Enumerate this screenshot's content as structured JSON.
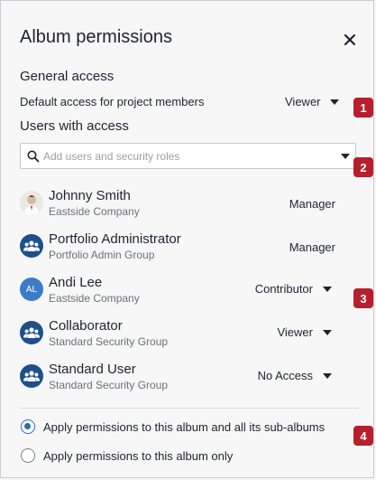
{
  "dialog": {
    "title": "Album permissions",
    "close_icon": "close-icon"
  },
  "general_access": {
    "heading": "General access",
    "label": "Default access for project members",
    "value": "Viewer"
  },
  "users_with_access": {
    "heading": "Users with access",
    "search_placeholder": "Add users and security roles",
    "search_value": ""
  },
  "users": [
    {
      "name": "Johnny Smith",
      "org": "Eastside Company",
      "role": "Manager",
      "editable": false,
      "avatar": "photo"
    },
    {
      "name": "Portfolio Administrator",
      "org": "Portfolio Admin Group",
      "role": "Manager",
      "editable": false,
      "avatar": "group-icon"
    },
    {
      "name": "Andi Lee",
      "org": "Eastside Company",
      "role": "Contributor",
      "editable": true,
      "avatar": "initials",
      "initials": "AL"
    },
    {
      "name": "Collaborator",
      "org": "Standard Security Group",
      "role": "Viewer",
      "editable": true,
      "avatar": "group-icon"
    },
    {
      "name": "Standard User",
      "org": "Standard Security Group",
      "role": "No Access",
      "editable": true,
      "avatar": "group-icon"
    }
  ],
  "apply_options": [
    {
      "label": "Apply permissions to this album and all its sub-albums",
      "checked": true
    },
    {
      "label": "Apply permissions to this album only",
      "checked": false
    }
  ],
  "badges": [
    "1",
    "2",
    "3",
    "4"
  ],
  "colors": {
    "badge": "#b51f2e",
    "accent": "#2a6ab8",
    "group_avatar": "#1d4f8c",
    "initials_avatar": "#3d7cc9"
  }
}
